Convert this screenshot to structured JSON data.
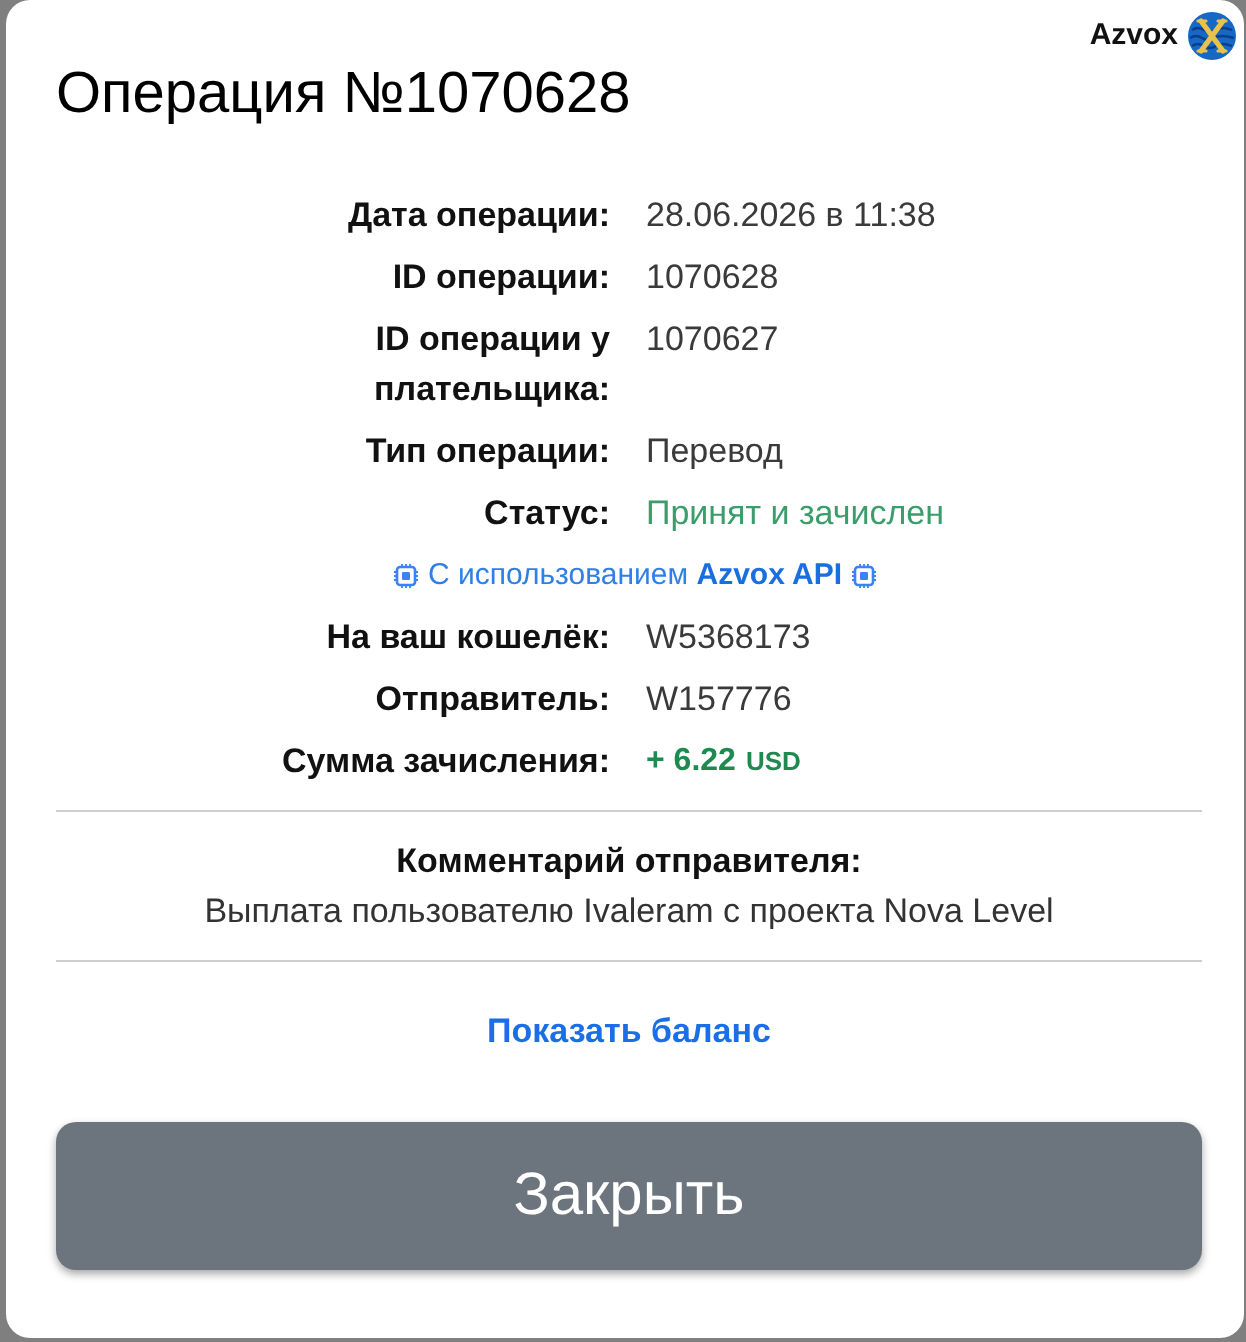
{
  "brand": {
    "name": "Azvox"
  },
  "title": "Операция №1070628",
  "details": [
    {
      "kind": "plain",
      "label": "Дата операции:",
      "value": "28.06.2026 в 11:38"
    },
    {
      "kind": "plain",
      "label": "ID операции:",
      "value": "1070628"
    },
    {
      "kind": "plain",
      "label": "ID операции у плательщика:",
      "value": "1070627"
    },
    {
      "kind": "plain",
      "label": "Тип операции:",
      "value": "Перевод"
    },
    {
      "kind": "status",
      "label": "Статус:",
      "value": "Принят и зачислен"
    },
    {
      "kind": "note",
      "text": "С использованием **Azvox API**"
    },
    {
      "kind": "plain",
      "label": "На ваш кошелёк:",
      "value": "W5368173"
    },
    {
      "kind": "plain",
      "label": "Отправитель:",
      "value": "W157776"
    },
    {
      "kind": "amount",
      "label": "Сумма зачисления:",
      "value": "+ 6.22",
      "currency": "USD"
    }
  ],
  "comment": {
    "title": "Комментарий отправителя:",
    "text": "Выплата пользователю Ivaleram с проекта Nova Level"
  },
  "link": "Показать баланс",
  "buttons": [
    "Закрыть"
  ]
}
